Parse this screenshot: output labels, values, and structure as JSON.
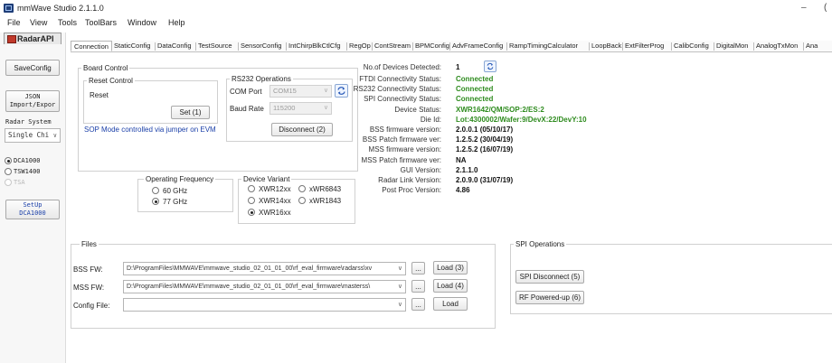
{
  "app": {
    "title": "mmWave Studio 2.1.1.0",
    "minimize": "–",
    "maximize": "(",
    "icon": "app-logo-icon"
  },
  "menu": [
    "File",
    "View",
    "Tools",
    "ToolBars",
    "Window",
    "Help"
  ],
  "left_panel": {
    "radar_tab": "RadarAPI",
    "save_config": "SaveConfig",
    "json_import": [
      "JSON",
      "Import/Expor"
    ],
    "radar_system_label": "Radar System",
    "radar_system_value": "Single Chi",
    "radios": [
      {
        "label": "DCA1000",
        "checked": true,
        "enabled": true
      },
      {
        "label": "TSW1400",
        "checked": false,
        "enabled": true
      },
      {
        "label": "TSA",
        "checked": false,
        "enabled": false
      }
    ],
    "setup": [
      "SetUp",
      "DCA1000"
    ]
  },
  "tabs": [
    "Connection",
    "StaticConfig",
    "DataConfig",
    "TestSource",
    "SensorConfig",
    "IntChirpBlkCtlCfg",
    "RegOp",
    "ContStream",
    "BPMConfig",
    "AdvFrameConfig",
    "RampTimingCalculator",
    "LoopBack",
    "ExtFilterProg",
    "CalibConfig",
    "DigitalMon",
    "AnalogTxMon",
    "Ana"
  ],
  "board_control": {
    "title": "Board Control",
    "reset_control": "Reset Control",
    "reset_label": "Reset",
    "set_button": "Set (1)",
    "sop_note": "SOP Mode controlled via jumper on EVM"
  },
  "rs232": {
    "title": "RS232 Operations",
    "com_port_label": "COM Port",
    "com_port_value": "COM15",
    "baud_rate_label": "Baud Rate",
    "baud_rate_value": "115200",
    "disconnect_button": "Disconnect (2)"
  },
  "operating_frequency": {
    "title": "Operating Frequency",
    "options": [
      {
        "label": "60 GHz",
        "checked": false
      },
      {
        "label": "77 GHz",
        "checked": true
      }
    ]
  },
  "device_variant": {
    "title": "Device Variant",
    "options": [
      {
        "label": "XWR12xx",
        "checked": false
      },
      {
        "label": "xWR6843",
        "checked": false
      },
      {
        "label": "XWR14xx",
        "checked": false
      },
      {
        "label": "xWR1843",
        "checked": false
      },
      {
        "label": "XWR16xx",
        "checked": true
      }
    ]
  },
  "status": {
    "devices_label": "No.of Devices Detected:",
    "devices_value": "1",
    "rows": [
      {
        "key": "FTDI Connectivity Status:",
        "value": "Connected",
        "ok": true
      },
      {
        "key": "RS232 Connectivity Status:",
        "value": "Connected",
        "ok": true
      },
      {
        "key": "SPI Connectivity Status:",
        "value": "Connected",
        "ok": true
      },
      {
        "key": "Device Status:",
        "value": "XWR1642/QM/SOP:2/ES:2",
        "ok": true
      },
      {
        "key": "Die Id:",
        "value": "Lot:4300002/Wafer:9/DevX:22/DevY:10",
        "ok": true
      },
      {
        "key": "BSS firmware version:",
        "value": "2.0.0.1 (05/10/17)",
        "ok": false
      },
      {
        "key": "BSS Patch firmware ver:",
        "value": "1.2.5.2 (30/04/19)",
        "ok": false
      },
      {
        "key": "MSS firmware version:",
        "value": "1.2.5.2 (16/07/19)",
        "ok": false
      },
      {
        "key": "MSS Patch firmware ver:",
        "value": "NA",
        "ok": false
      },
      {
        "key": "GUI Version:",
        "value": "2.1.1.0",
        "ok": false
      },
      {
        "key": "Radar Link Version:",
        "value": "2.0.9.0 (31/07/19)",
        "ok": false
      },
      {
        "key": "Post Proc Version:",
        "value": "4.86",
        "ok": false
      }
    ],
    "ok_color": "#2e8b1e"
  },
  "files": {
    "title": "Files",
    "rows": [
      {
        "label": "BSS FW:",
        "value": "D:\\ProgramFiles\\MMWAVE\\mmwave_studio_02_01_01_00\\rf_eval_firmware\\radarss\\xv",
        "browse": "...",
        "load": "Load (3)"
      },
      {
        "label": "MSS FW:",
        "value": "D:\\ProgramFiles\\MMWAVE\\mmwave_studio_02_01_01_00\\rf_eval_firmware\\masterss\\",
        "browse": "...",
        "load": "Load (4)"
      },
      {
        "label": "Config File:",
        "value": "",
        "browse": "...",
        "load": "Load"
      }
    ]
  },
  "spi": {
    "title": "SPI Operations",
    "disconnect_button": "SPI Disconnect (5)",
    "rf_button": "RF Powered-up (6)"
  }
}
